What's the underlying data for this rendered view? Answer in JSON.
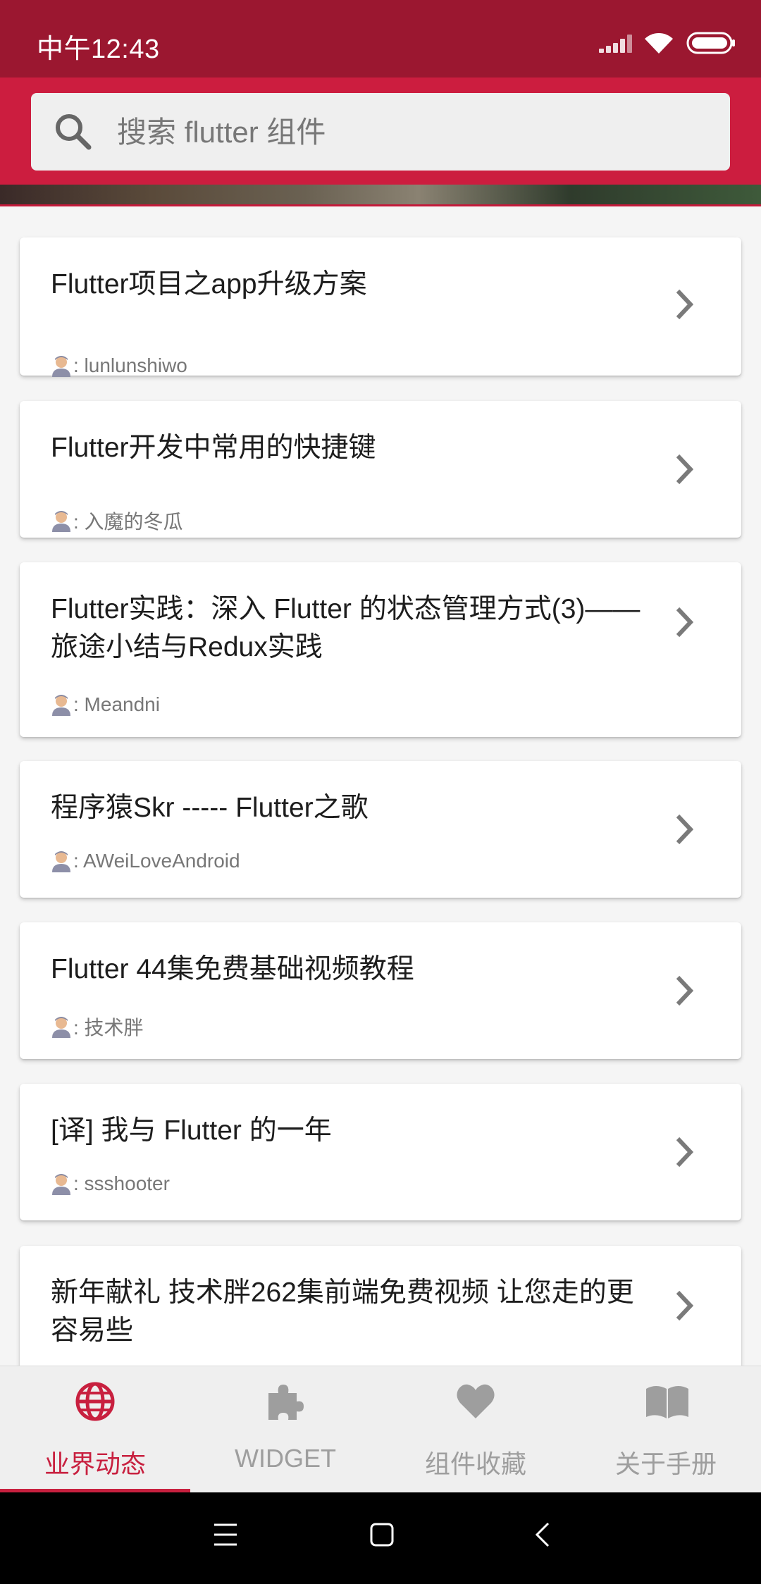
{
  "status_bar": {
    "time": "中午12:43",
    "icons": [
      "signal-icon",
      "wifi-icon",
      "battery-icon"
    ]
  },
  "search": {
    "placeholder": "搜索 flutter 组件",
    "value": ""
  },
  "articles": [
    {
      "title": "Flutter项目之app升级方案",
      "author": ": lunlunshiwo"
    },
    {
      "title": "Flutter开发中常用的快捷键",
      "author": ": 入魔的冬瓜"
    },
    {
      "title": "Flutter实践：深入 Flutter 的状态管理方式(3)——旅途小结与Redux实践",
      "author": ": Meandni"
    },
    {
      "title": "程序猿Skr ----- Flutter之歌",
      "author": ": AWeiLoveAndroid"
    },
    {
      "title": "Flutter 44集免费基础视频教程",
      "author": ": 技术胖"
    },
    {
      "title": "[译] 我与 Flutter 的一年",
      "author": ": ssshooter"
    },
    {
      "title": "新年献礼 技术胖262集前端免费视频 让您走的更容易些",
      "author": ""
    }
  ],
  "bottom_nav": {
    "active_index": 0,
    "items": [
      {
        "label": "业界动态",
        "icon": "globe-icon"
      },
      {
        "label": "WIDGET",
        "icon": "puzzle-icon"
      },
      {
        "label": "组件收藏",
        "icon": "heart-icon"
      },
      {
        "label": "关于手册",
        "icon": "book-icon"
      }
    ]
  },
  "colors": {
    "primary": "#cc1d3f",
    "status_bar": "#9b1730",
    "active": "#c8203f",
    "inactive": "#9e9e9e"
  }
}
